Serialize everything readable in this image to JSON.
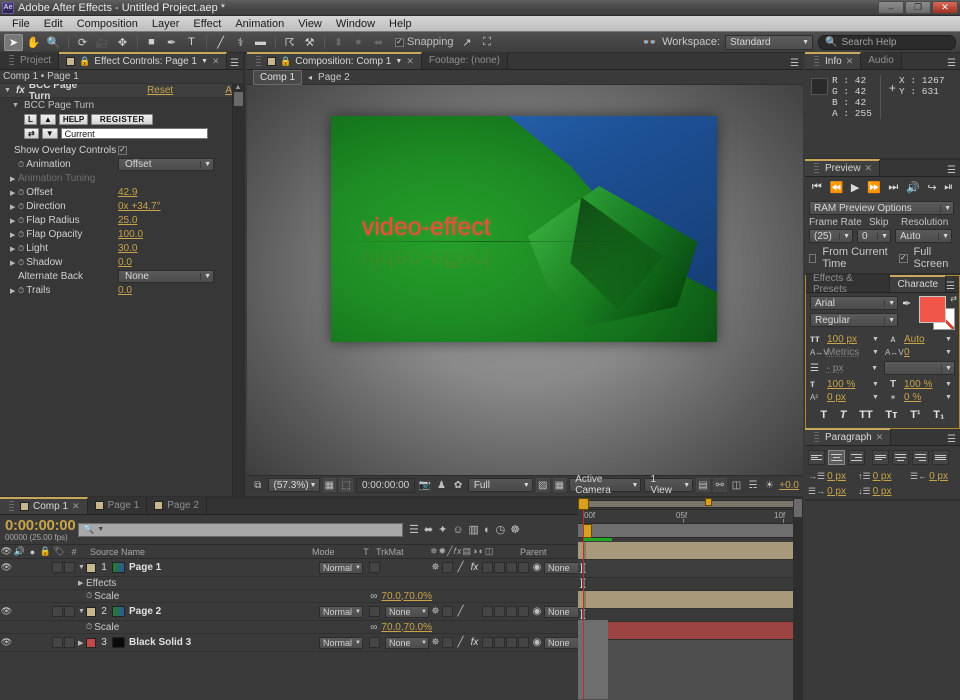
{
  "window": {
    "app_icon": "Ae",
    "title": "Adobe After Effects - Untitled Project.aep *",
    "minimize": "–",
    "restore": "❐",
    "close": "✕"
  },
  "menubar": {
    "items": [
      "File",
      "Edit",
      "Composition",
      "Layer",
      "Effect",
      "Animation",
      "View",
      "Window",
      "Help"
    ]
  },
  "toolbar": {
    "tools": [
      {
        "name": "selection-tool",
        "glyph": "➤"
      },
      {
        "name": "hand-tool",
        "glyph": "✋"
      },
      {
        "name": "zoom-tool",
        "glyph": "🔍"
      },
      {
        "name": "rotation-tool",
        "glyph": "⟳"
      },
      {
        "name": "camera-tool",
        "glyph": "🎥"
      },
      {
        "name": "pan-behind-tool",
        "glyph": "✥"
      },
      {
        "name": "rectangle-tool",
        "glyph": "■"
      },
      {
        "name": "pen-tool",
        "glyph": "✒"
      },
      {
        "name": "type-tool",
        "glyph": "T"
      },
      {
        "name": "brush-tool",
        "glyph": "╱"
      },
      {
        "name": "clone-stamp-tool",
        "glyph": "⚕"
      },
      {
        "name": "eraser-tool",
        "glyph": "▬"
      },
      {
        "name": "roto-brush-tool",
        "glyph": "☈"
      },
      {
        "name": "puppet-pin-tool",
        "glyph": "⚒"
      }
    ],
    "dim_tools": [
      {
        "name": "align-tool",
        "glyph": "⬍"
      },
      {
        "name": "dot-tool",
        "glyph": "●"
      },
      {
        "name": "mirror-tool",
        "glyph": "⬌"
      }
    ],
    "snapping_label": "Snapping",
    "snapping_checked": "✓",
    "extra_tools": [
      {
        "name": "diagonal-tool",
        "glyph": "↗"
      },
      {
        "name": "bracket-tool",
        "glyph": "⛶"
      }
    ],
    "workspace_label": "Workspace:",
    "workspace_value": "Standard",
    "search_placeholder": "Search Help",
    "search_icon": "🔍"
  },
  "effect_controls": {
    "tabs": [
      {
        "label": "Project",
        "active": false,
        "closable": false
      },
      {
        "label": "Effect Controls: Page 1",
        "active": true,
        "closable": true
      }
    ],
    "breadcrumb": "Comp 1 • Page 1",
    "effect_name": "BCC Page Turn",
    "reset_label": "Reset",
    "about_label": "Abo",
    "group_name": "BCC Page Turn",
    "mini_buttons": [
      "L",
      "▲",
      "HELP",
      "REGISTER"
    ],
    "mini_buttons_row2": [
      "⇄",
      "▼"
    ],
    "preset_field_value": "Current",
    "show_overlay_label": "Show Overlay Controls",
    "show_overlay_checked": "✓",
    "properties": [
      {
        "name": "Animation",
        "value": "Offset",
        "type": "dropdown",
        "stopwatch": true,
        "disabled": false,
        "expandable": false
      },
      {
        "name": "Animation Tuning",
        "value": "",
        "type": "group",
        "stopwatch": false,
        "disabled": true,
        "expandable": true
      },
      {
        "name": "Offset",
        "value": "42.9",
        "type": "number",
        "stopwatch": true,
        "disabled": false,
        "expandable": true
      },
      {
        "name": "Direction",
        "value": "0x +34.7°",
        "type": "number",
        "stopwatch": true,
        "disabled": false,
        "expandable": true
      },
      {
        "name": "Flap Radius",
        "value": "25.0",
        "type": "number",
        "stopwatch": true,
        "disabled": false,
        "expandable": true
      },
      {
        "name": "Flap Opacity",
        "value": "100.0",
        "type": "number",
        "stopwatch": true,
        "disabled": false,
        "expandable": true
      },
      {
        "name": "Light",
        "value": "30.0",
        "type": "number",
        "stopwatch": true,
        "disabled": false,
        "expandable": true
      },
      {
        "name": "Shadow",
        "value": "0.0",
        "type": "number",
        "stopwatch": true,
        "disabled": false,
        "expandable": true
      },
      {
        "name": "Alternate Back",
        "value": "None",
        "type": "dropdown",
        "stopwatch": false,
        "disabled": false,
        "expandable": false
      },
      {
        "name": "Trails",
        "value": "0.0",
        "type": "number",
        "stopwatch": true,
        "disabled": false,
        "expandable": true
      }
    ]
  },
  "composition": {
    "tabs": [
      {
        "label": "Composition: Comp 1",
        "active": true,
        "closable": true
      },
      {
        "label": "Footage: (none)",
        "active": false,
        "closable": false
      }
    ],
    "breadcrumb_comp": "Comp 1",
    "breadcrumb_sep": "◂",
    "breadcrumb_layer": "Page 2",
    "stage_text": "video-effect",
    "stage_text_color": "#e8503c",
    "page_green": "#1e8c24",
    "page_blue": "#1d4f93",
    "toolbar": {
      "zoom": "(57.3%)",
      "timecode": "0:00:00:00",
      "resolution": "Full",
      "view": "Active Camera",
      "views": "1 View",
      "exposure": "+0.0",
      "icons": [
        {
          "name": "region-of-interest-icon",
          "glyph": "⧉"
        },
        {
          "name": "grid-guides-icon",
          "glyph": "▦"
        },
        {
          "name": "mask-icon",
          "glyph": "⬚"
        },
        {
          "name": "snapshot-icon",
          "glyph": "📷"
        },
        {
          "name": "show-snapshot-icon",
          "glyph": "♟"
        },
        {
          "name": "channel-icon",
          "glyph": "✿"
        },
        {
          "name": "transparency-grid-icon",
          "glyph": "▨"
        },
        {
          "name": "timeline-icon",
          "glyph": "▤"
        },
        {
          "name": "comp-flowchart-icon",
          "glyph": "⚯"
        },
        {
          "name": "renderer-icon",
          "glyph": "◫"
        },
        {
          "name": "three-d-icon",
          "glyph": "☴"
        },
        {
          "name": "exposure-icon",
          "glyph": "☀"
        }
      ]
    }
  },
  "info_panel": {
    "tabs": [
      {
        "label": "Info",
        "active": true,
        "closable": true
      },
      {
        "label": "Audio",
        "active": false,
        "closable": false
      }
    ],
    "r": "R : 42",
    "g": "G : 42",
    "b": "B : 42",
    "a": "A : 255",
    "x": "X : 1267",
    "y": "Y : 631",
    "crosshair": "+"
  },
  "preview_panel": {
    "tab": "Preview",
    "buttons": [
      {
        "name": "first-frame-button",
        "glyph": "⏮"
      },
      {
        "name": "previous-frame-button",
        "glyph": "⏪"
      },
      {
        "name": "play-button",
        "glyph": "▶"
      },
      {
        "name": "next-frame-button",
        "glyph": "⏩"
      },
      {
        "name": "last-frame-button",
        "glyph": "⏭"
      },
      {
        "name": "audio-button",
        "glyph": "🔊"
      },
      {
        "name": "loop-button",
        "glyph": "↪"
      },
      {
        "name": "ram-preview-button",
        "glyph": "⏯"
      }
    ],
    "options_label": "RAM Preview Options",
    "frame_rate_label": "Frame Rate",
    "frame_rate_value": "(25)",
    "skip_label": "Skip",
    "skip_value": "0",
    "resolution_label": "Resolution",
    "resolution_value": "Auto",
    "from_current_time_label": "From Current Time",
    "from_current_time_checked": false,
    "full_screen_label": "Full Screen",
    "full_screen_checked": true,
    "full_screen_check": "✓"
  },
  "character_panel": {
    "tabs": [
      {
        "label": "Effects & Presets",
        "active": false,
        "closable": false
      },
      {
        "label": "Characte",
        "active": true,
        "closable": false
      }
    ],
    "font_family": "Arial",
    "font_style": "Regular",
    "eyedropper_icon": "✒",
    "swap_icon": "⇄",
    "font_size_icon": "ᴛᴛ",
    "font_size": "100 px",
    "leading_icon": "ᴀ",
    "leading": "Auto",
    "kerning_icon": "A↔V",
    "kerning": "Metrics",
    "tracking_icon": "A↔V",
    "tracking": "0",
    "stroke_icon": "☰",
    "stroke_width": "- px",
    "stroke_type": "",
    "vscale_icon": "ᴛ",
    "vertical_scale": "100 %",
    "hscale_icon": "T",
    "horizontal_scale": "100 %",
    "baseline_icon": "A²",
    "baseline_shift": "0 px",
    "tsume_icon": "✶",
    "tsume": "0 %",
    "styles": [
      {
        "name": "faux-bold-button",
        "glyph": "T"
      },
      {
        "name": "faux-italic-button",
        "glyph": "T"
      },
      {
        "name": "all-caps-button",
        "glyph": "TT"
      },
      {
        "name": "small-caps-button",
        "glyph": "Tт"
      },
      {
        "name": "superscript-button",
        "glyph": "T¹"
      },
      {
        "name": "subscript-button",
        "glyph": "T₁"
      }
    ]
  },
  "paragraph_panel": {
    "tab": "Paragraph",
    "align_buttons": [
      {
        "name": "align-left-button",
        "selected": false
      },
      {
        "name": "align-center-button",
        "selected": true
      },
      {
        "name": "align-right-button",
        "selected": false
      },
      {
        "name": "justify-last-left-button",
        "selected": false
      },
      {
        "name": "justify-last-center-button",
        "selected": false
      },
      {
        "name": "justify-last-right-button",
        "selected": false
      },
      {
        "name": "justify-all-button",
        "selected": false
      }
    ],
    "indent_left": "0 px",
    "space_before": "0 px",
    "indent_right": "0 px",
    "indent_first": "0 px",
    "space_after": "0 px"
  },
  "timeline": {
    "tabs": [
      {
        "label": "Comp 1",
        "active": true,
        "closable": true
      },
      {
        "label": "Page 1",
        "active": false,
        "closable": false
      },
      {
        "label": "Page 2",
        "active": false,
        "closable": false
      }
    ],
    "current_time": "0:00:00:00",
    "frame_info": "00000 (25.00 fps)",
    "search_placeholder": "",
    "search_icon": "🔍",
    "toolbar_icons": [
      {
        "name": "composition-mini-flowchart-icon",
        "glyph": "⬌"
      },
      {
        "name": "draft-3d-icon",
        "glyph": "✦"
      },
      {
        "name": "hide-shy-layers-icon",
        "glyph": "☺"
      },
      {
        "name": "frame-blending-icon",
        "glyph": "▥"
      },
      {
        "name": "motion-blur-icon",
        "glyph": "◐"
      },
      {
        "name": "graph-editor-icon",
        "glyph": "◷"
      },
      {
        "name": "brainstorm-icon",
        "glyph": "☸"
      }
    ],
    "columns": [
      "#",
      "Source Name",
      "Mode",
      "T",
      "TrkMat",
      "Parent"
    ],
    "switch_icons": [
      "✵",
      "✹",
      "╱",
      "fx",
      "▤",
      "◑",
      "◐",
      "◫"
    ],
    "header_icons": [
      "👁",
      "🔊",
      "●",
      "🔒"
    ],
    "layers": [
      {
        "index": "1",
        "name": "Page 1",
        "color": "#c8b68e",
        "mode": "Normal",
        "trkmat": "",
        "parent": "None",
        "has_fx": true,
        "expanded": true,
        "bar_color": "#a8997a",
        "children": [
          {
            "name": "Effects",
            "type": "group",
            "value": ""
          },
          {
            "name": "Scale",
            "type": "property",
            "value": "70.0,70.0%"
          }
        ]
      },
      {
        "index": "2",
        "name": "Page 2",
        "color": "#c8b68e",
        "mode": "Normal",
        "trkmat": "None",
        "parent": "None",
        "has_fx": false,
        "expanded": true,
        "bar_color": "#a8997a",
        "children": [
          {
            "name": "Scale",
            "type": "property",
            "value": "70.0,70.0%"
          }
        ]
      },
      {
        "index": "3",
        "name": "Black Solid 3",
        "color": "#c04a4a",
        "mode": "Normal",
        "trkmat": "None",
        "parent": "None",
        "has_fx": true,
        "expanded": false,
        "bar_color": "#9c4444",
        "children": []
      }
    ],
    "ruler": {
      "labels": [
        "00f",
        "05f",
        "10f"
      ],
      "positions": [
        2,
        45,
        88
      ]
    }
  }
}
